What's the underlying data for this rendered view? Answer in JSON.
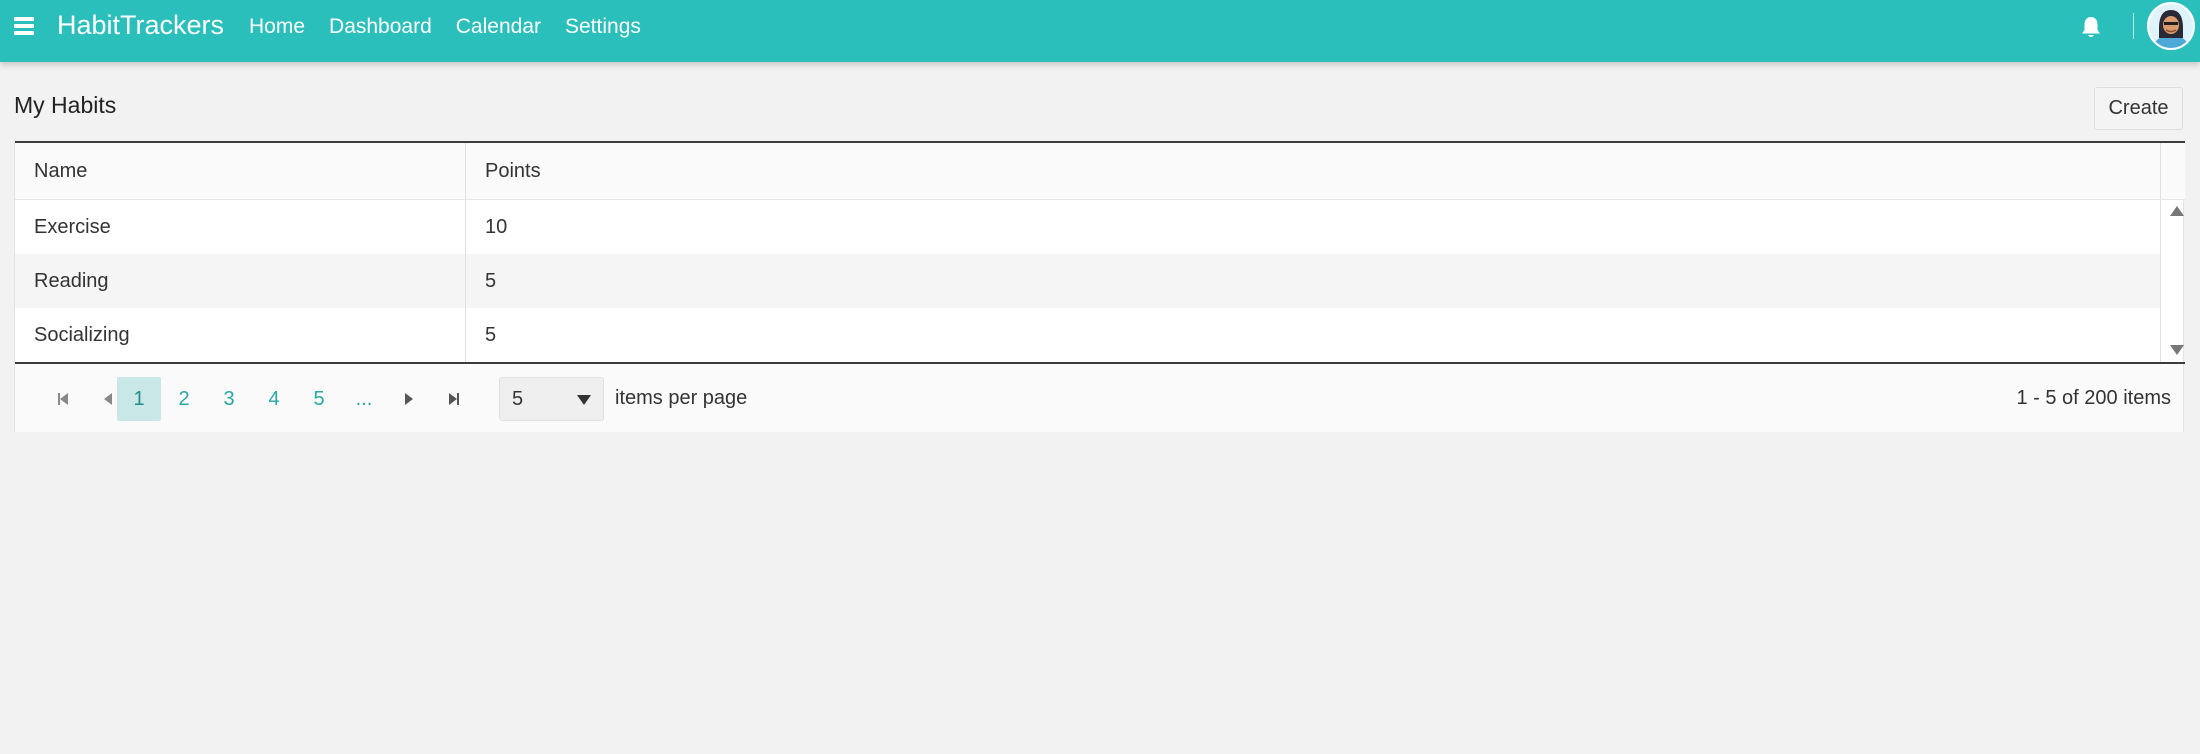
{
  "app": {
    "brand": "HabitTrackers",
    "accent_color": "#2bbfbc"
  },
  "nav": {
    "items": [
      {
        "label": "Home"
      },
      {
        "label": "Dashboard"
      },
      {
        "label": "Calendar"
      },
      {
        "label": "Settings"
      }
    ]
  },
  "header_icons": {
    "menu": "hamburger-icon",
    "notifications": "bell-icon",
    "user": "avatar"
  },
  "page": {
    "title": "My Habits",
    "create_label": "Create"
  },
  "grid": {
    "columns": [
      "Name",
      "Points"
    ],
    "rows": [
      {
        "name": "Exercise",
        "points": "10"
      },
      {
        "name": "Reading",
        "points": "5"
      },
      {
        "name": "Socializing",
        "points": "5"
      }
    ]
  },
  "pager": {
    "pages": [
      "1",
      "2",
      "3",
      "4",
      "5",
      "..."
    ],
    "current_page": "1",
    "page_size": "5",
    "page_size_label": "items per page",
    "info": "1 - 5 of 200 items"
  }
}
